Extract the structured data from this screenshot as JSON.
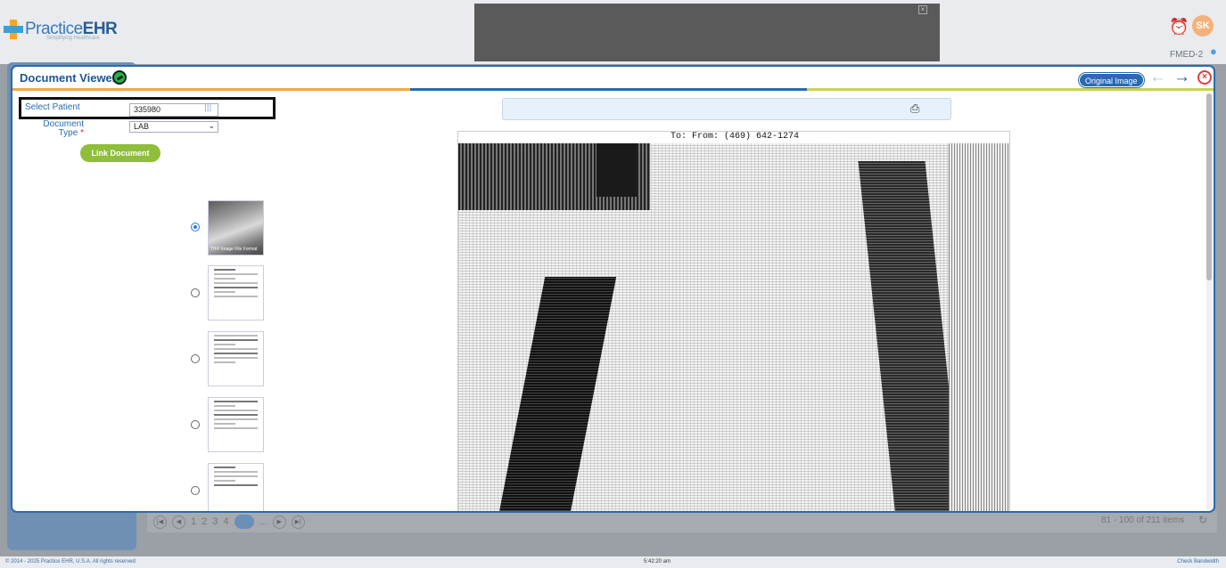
{
  "app": {
    "logo_text": "Practice",
    "logo_text_bold": "EHR",
    "logo_tagline": "Simplifying Healthcare",
    "avatar_initials": "SK",
    "location": "FMED-2"
  },
  "modal": {
    "title": "Document Viewer",
    "original_image_label": "Original Image",
    "prev_icon": "arrow-left-icon",
    "next_icon": "arrow-right-icon",
    "close_icon": "close-icon"
  },
  "form": {
    "select_patient_label": "Select Patient",
    "patient_value": "335980",
    "document_type_label": "Document Type",
    "required_mark": "*",
    "document_type_value": "LAB",
    "link_button_label": "Link Document"
  },
  "thumbnails": [
    {
      "selected": true,
      "caption": "TIFF Image File Format"
    },
    {
      "selected": false
    },
    {
      "selected": false
    },
    {
      "selected": false
    },
    {
      "selected": false
    }
  ],
  "viewer": {
    "fax_header": "To:  From: (469) 642-1274"
  },
  "pager": {
    "pages": [
      "1",
      "2",
      "3",
      "4"
    ],
    "ellipsis": "...",
    "info": "81 - 100 of 211 items"
  },
  "footer": {
    "copyright": "© 2014 - 2025 Practice EHR, U.S.A. All rights reserved",
    "time": "5:42:20 am",
    "check_bandwidth": "Check Bandwidth"
  },
  "colors": {
    "accent": "#2a6ab0",
    "link_button": "#8fbe3a",
    "close": "#e23b3b"
  }
}
